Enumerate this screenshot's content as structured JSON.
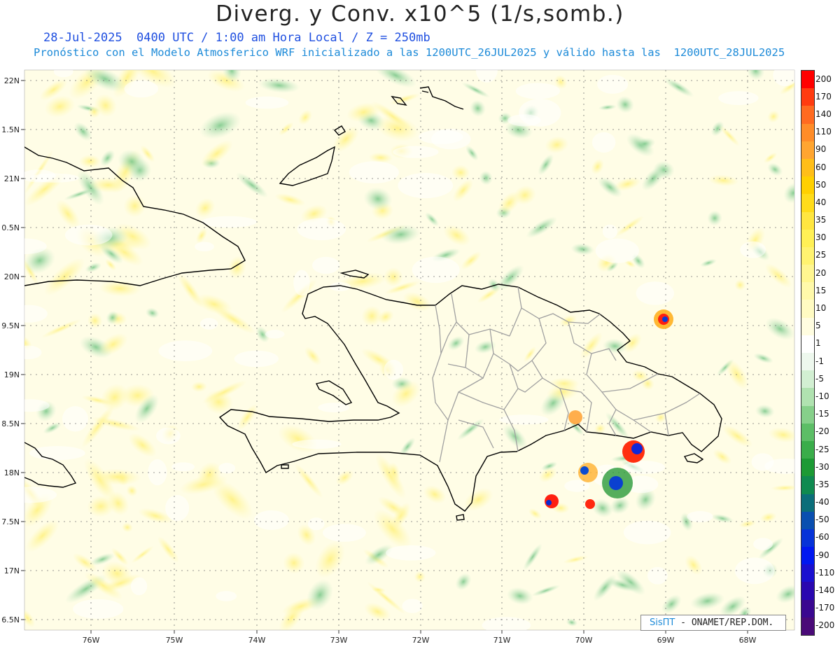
{
  "header": {
    "title": "Diverg. y Conv. x10^5 (1/s,somb.)",
    "subtitle_time": "28-Jul-2025  0400 UTC / 1:00 am Hora Local / Z = 250mb",
    "subtitle_model": "Pronóstico con el Modelo Atmosferico WRF inicializado a las 1200UTC_26JUL2025 y válido hasta las  1200UTC_28JUL2025"
  },
  "map": {
    "lat_labels": [
      "22N",
      "1.5N",
      "21N",
      "0.5N",
      "20N",
      "9.5N",
      "19N",
      "8.5N",
      "18N",
      "7.5N",
      "17N",
      "6.5N"
    ],
    "lon_labels": [
      "76W",
      "75W",
      "74W",
      "73W",
      "72W",
      "71W",
      "70W",
      "69W",
      "68W"
    ],
    "lon_range": [
      -76.6,
      -67.6
    ],
    "lat_range": [
      16.5,
      22
    ],
    "grid": "dotted",
    "coastline_color": "#000000",
    "province_border_color": "#a0a0a0"
  },
  "credit": {
    "brand": "SisПT",
    "text": " - ONAMET/REP.DOM."
  },
  "colorbar": {
    "labels": [
      "200",
      "170",
      "140",
      "110",
      "90",
      "60",
      "50",
      "40",
      "35",
      "30",
      "25",
      "20",
      "15",
      "10",
      "5",
      "1",
      "-1",
      "-5",
      "-10",
      "-15",
      "-20",
      "-25",
      "-30",
      "-35",
      "-40",
      "-50",
      "-60",
      "-90",
      "-110",
      "-140",
      "-170",
      "-200"
    ],
    "colors": [
      "#ff0000",
      "#ff3b10",
      "#ff6a20",
      "#ff8c28",
      "#ffa530",
      "#ffbe18",
      "#ffd000",
      "#ffdc1a",
      "#ffe640",
      "#fff055",
      "#fff370",
      "#fff690",
      "#fff9aa",
      "#fffbc2",
      "#fffde0",
      "#ffffff",
      "#eef8ee",
      "#d2efd2",
      "#b0e2b0",
      "#86d08a",
      "#5cbe66",
      "#3aad4a",
      "#1c9a34",
      "#0f8a50",
      "#0b6e7a",
      "#0a4fb0",
      "#0633d8",
      "#0018f0",
      "#1a10d0",
      "#2a08b0",
      "#3a0890",
      "#4a0a78"
    ]
  }
}
